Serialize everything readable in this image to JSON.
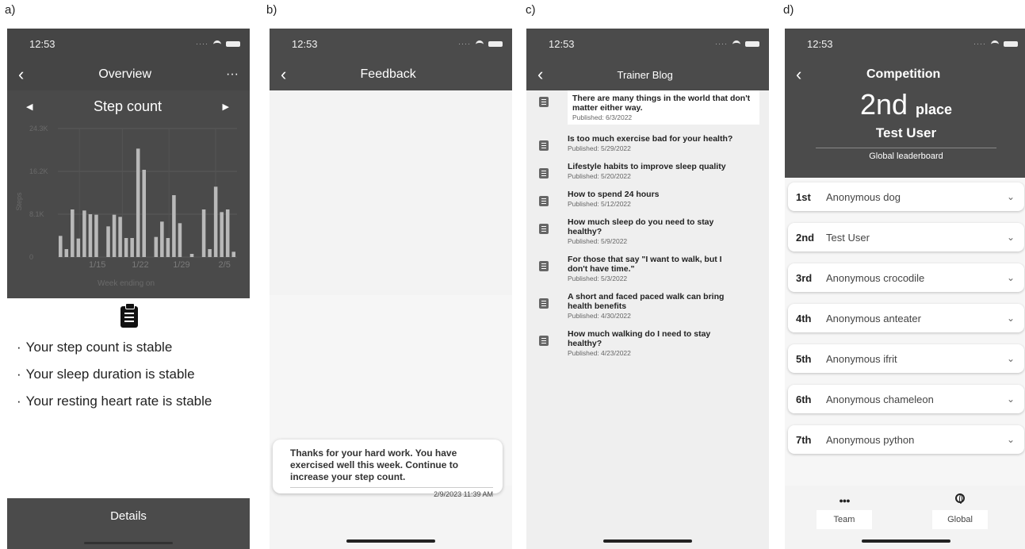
{
  "labels": {
    "a": "a)",
    "b": "b)",
    "c": "c)",
    "d": "d)"
  },
  "status_time": "12:53",
  "panel_a": {
    "nav_title": "Overview",
    "more_label": "···",
    "chart_title": "Step count",
    "details_label": "Details",
    "summary": [
      "Your step count is stable",
      "Your sleep duration is stable",
      "Your resting heart rate is stable"
    ]
  },
  "chart_data": {
    "type": "bar",
    "title": "Step count",
    "xlabel": "Week ending on",
    "ylabel": "Steps",
    "y_ticks": [
      "0",
      "8.1K",
      "16.2K",
      "24.3K"
    ],
    "x_ticks": [
      "1/15",
      "1/22",
      "1/29",
      "2/5"
    ],
    "ylim": [
      0,
      24300
    ],
    "values": [
      4000,
      1500,
      9000,
      3500,
      8800,
      8100,
      8000,
      0,
      5800,
      8000,
      7600,
      3600,
      3600,
      20500,
      16500,
      0,
      3800,
      6700,
      3600,
      11700,
      6400,
      0,
      600,
      0,
      9000,
      1500,
      13300,
      8500,
      9000,
      1000
    ],
    "grid": true,
    "legend": "none"
  },
  "panel_b": {
    "nav_title": "Feedback",
    "message": "Thanks for your hard work. You have exercised well this week. Continue to increase your step count.",
    "timestamp": "2/9/2023 11:39 AM"
  },
  "panel_c": {
    "nav_title": "Trainer Blog",
    "posts": [
      {
        "title": "There are many things in the world that don't matter either way.",
        "published": "Published: 6/3/2022"
      },
      {
        "title": "Is too much exercise bad for your health?",
        "published": "Published: 5/29/2022"
      },
      {
        "title": "Lifestyle habits to improve sleep quality",
        "published": "Published: 5/20/2022"
      },
      {
        "title": "How to spend 24 hours",
        "published": "Published: 5/12/2022"
      },
      {
        "title": "How much sleep do you need to stay healthy?",
        "published": "Published: 5/9/2022"
      },
      {
        "title": "For those that say \"I want to walk, but I don't have time.\"",
        "published": "Published: 5/3/2022"
      },
      {
        "title": "A short and faced paced walk can bring health benefits",
        "published": "Published: 4/30/2022"
      },
      {
        "title": "How much walking do I need to stay healthy?",
        "published": "Published: 4/23/2022"
      }
    ]
  },
  "panel_d": {
    "nav_title": "Competition",
    "place_number": "2nd",
    "place_suffix": "place",
    "user": "Test User",
    "board": "Global leaderboard",
    "leaderboard": [
      {
        "rank": "1st",
        "name": "Anonymous dog"
      },
      {
        "rank": "2nd",
        "name": "Test User"
      },
      {
        "rank": "3rd",
        "name": "Anonymous crocodile"
      },
      {
        "rank": "4th",
        "name": "Anonymous anteater"
      },
      {
        "rank": "5th",
        "name": "Anonymous ifrit"
      },
      {
        "rank": "6th",
        "name": "Anonymous chameleon"
      },
      {
        "rank": "7th",
        "name": "Anonymous python"
      }
    ],
    "tabs": {
      "team": "Team",
      "global": "Global"
    }
  }
}
